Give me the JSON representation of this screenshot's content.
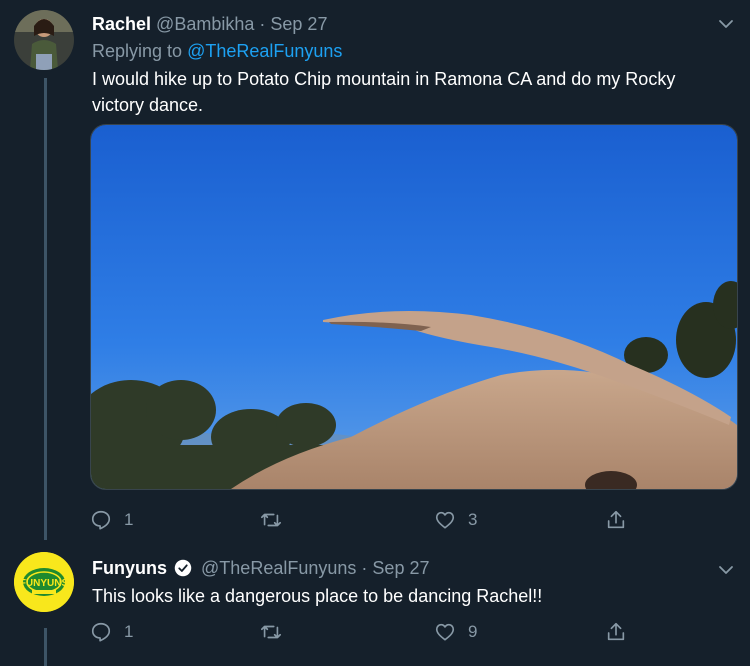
{
  "tweets": [
    {
      "name": "Rachel",
      "handle": "@Bambikha",
      "sep": "·",
      "date": "Sep 27",
      "replying_prefix": "Replying to",
      "replying_handle": "@TheRealFunyuns",
      "text": "I would hike up to Potato Chip mountain in Ramona CA and do my Rocky victory dance.",
      "reply_count": "1",
      "retweet_count": "",
      "like_count": "3"
    },
    {
      "name": "Funyuns",
      "handle": "@TheRealFunyuns",
      "sep": "·",
      "date": "Sep 27",
      "text": "This looks like a dangerous place to be dancing Rachel!!",
      "reply_count": "1",
      "retweet_count": "",
      "like_count": "9",
      "avatar_text": "FUNYUNS"
    }
  ],
  "colors": {
    "background": "#15202b",
    "accent": "#1da1f2",
    "muted": "#8899a6",
    "brand_yellow": "#f8e71c"
  }
}
